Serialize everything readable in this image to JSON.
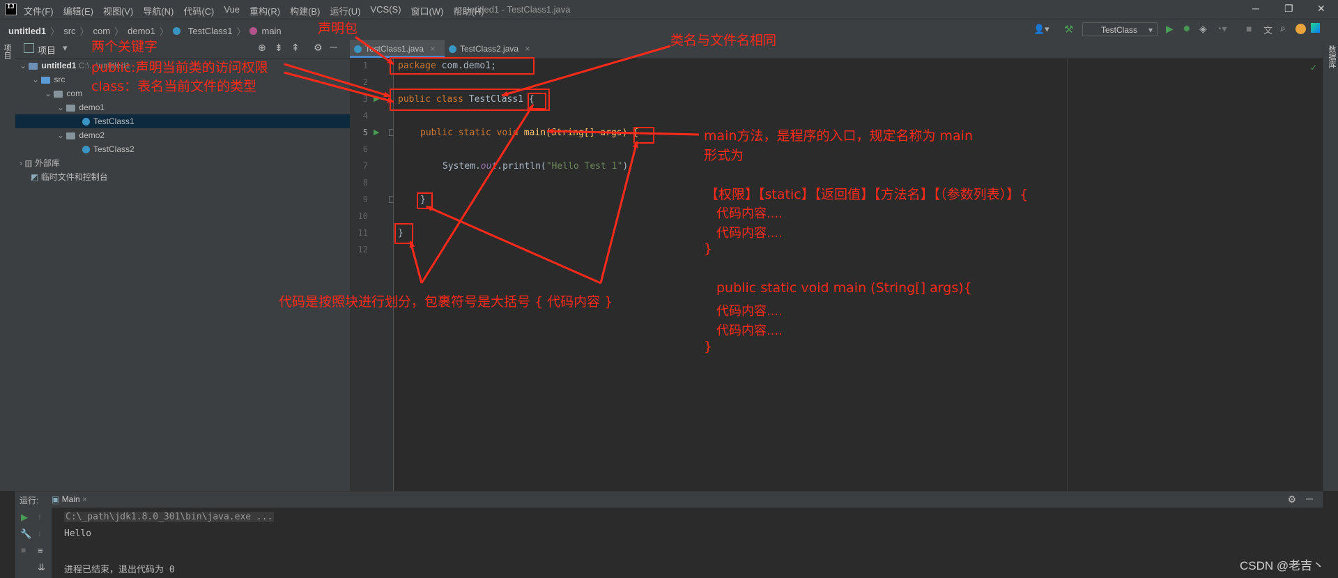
{
  "menubar": {
    "logo": "IJ",
    "items": [
      "文件(F)",
      "编辑(E)",
      "视图(V)",
      "导航(N)",
      "代码(C)",
      "Vue",
      "重构(R)",
      "构建(B)",
      "运行(U)",
      "VCS(S)",
      "窗口(W)",
      "帮助(H)"
    ],
    "window_title": "untitled1 - TestClass1.java"
  },
  "breadcrumb": {
    "project": "untitled1",
    "items": [
      "src",
      "com",
      "demo1",
      "TestClass1",
      "main"
    ]
  },
  "run_config": "TestClass",
  "project_panel": {
    "title": "项目",
    "tree": [
      {
        "label": "untitled1",
        "suffix": "C:\\...\\untitled1",
        "depth": 0,
        "kind": "module"
      },
      {
        "label": "src",
        "depth": 1,
        "kind": "folder"
      },
      {
        "label": "com",
        "depth": 2,
        "kind": "folder"
      },
      {
        "label": "demo1",
        "depth": 3,
        "kind": "folder"
      },
      {
        "label": "TestClass1",
        "depth": 4,
        "kind": "class",
        "selected": true
      },
      {
        "label": "demo2",
        "depth": 3,
        "kind": "folder"
      },
      {
        "label": "TestClass2",
        "depth": 4,
        "kind": "class"
      },
      {
        "label": "外部库",
        "depth": 0,
        "kind": "library"
      },
      {
        "label": "临时文件和控制台",
        "depth": 0,
        "kind": "scratch"
      }
    ]
  },
  "left_tool_label": "项目",
  "right_tool_label": "数据库",
  "editor_tabs": [
    {
      "label": "TestClass1.java",
      "active": true
    },
    {
      "label": "TestClass2.java",
      "active": false
    }
  ],
  "code": {
    "line_numbers": [
      "1",
      "2",
      "3",
      "4",
      "5",
      "6",
      "7",
      "8",
      "9",
      "10",
      "11",
      "12"
    ],
    "line1_kw": "package",
    "line1_rest": " com.demo1;",
    "line3_kw": "public class",
    "line3_rest": " TestClass1 {",
    "line5_kw": "public static void",
    "line5_rest": " main(String[] args) {",
    "line7_a": "System.",
    "line7_field": "out",
    "line7_b": ".println(",
    "line7_str": "\"Hello Test 1\"",
    "line7_c": ");",
    "line9": "}",
    "line11": "}"
  },
  "run_panel": {
    "label": "运行:",
    "tab": "Main",
    "lines": [
      "C:\\_path\\jdk1.8.0_301\\bin\\java.exe ...",
      "Hello",
      "",
      "进程已结束，退出代码为 0"
    ]
  },
  "annotations": {
    "declare_package": "声明包",
    "two_keywords": "两个关键字",
    "public_desc": "public:声明当前类的访问权限",
    "class_desc": "class：表名当前文件的类型",
    "classname_rule": "类名与文件名相同",
    "main_desc_1": "main方法，是程序的入口，规定名称为  main",
    "main_desc_2": "形式为",
    "main_form": "【权限】【static】【返回值】【方法名】【（参数列表）】{",
    "code_content_1": "代码内容....",
    "code_content_2": "代码内容....",
    "close_brace": "}",
    "example_sig": "public static void main (String[] args){",
    "code_content_3": "代码内容....",
    "code_content_4": "代码内容....",
    "close_brace_2": "}",
    "block_desc": "代码是按照块进行划分，包裹符号是大括号   {  代码内容  }"
  },
  "watermark": "CSDN @老吉丶",
  "colors": {
    "annotation_red": "#ff2a1a",
    "keyword": "#cc7832",
    "string": "#6a8759",
    "field": "#9876aa",
    "run_green": "#499c54"
  }
}
